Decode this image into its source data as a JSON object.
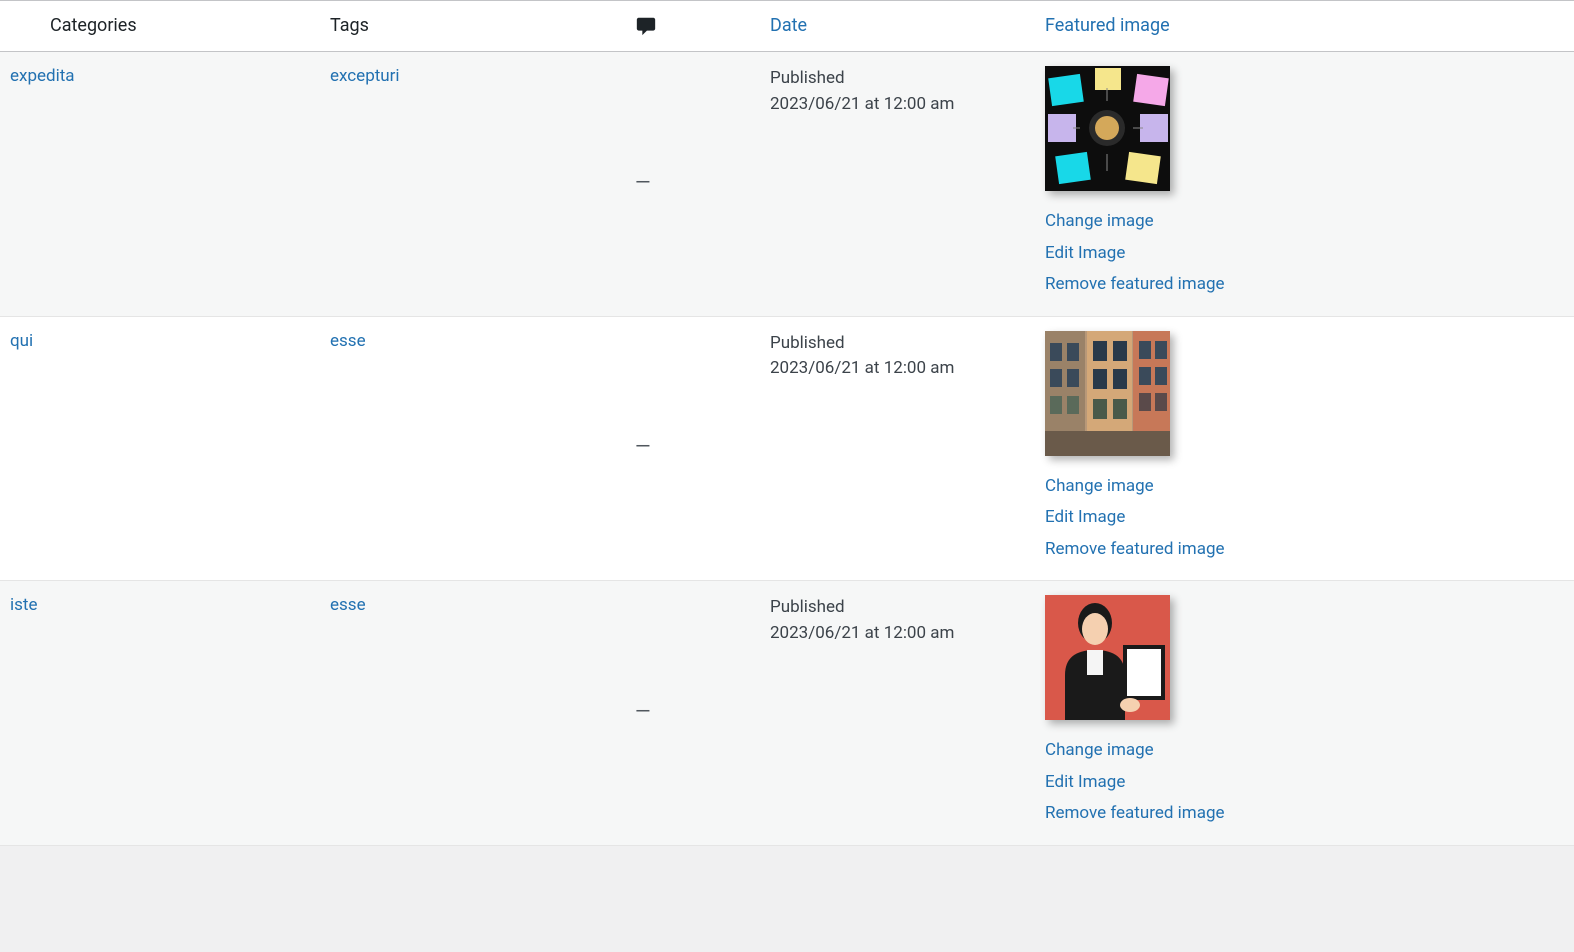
{
  "headers": {
    "categories": "Categories",
    "tags": "Tags",
    "date": "Date",
    "featured": "Featured image"
  },
  "rows": [
    {
      "category": "expedita",
      "tag": "excepturi",
      "comments": "—",
      "status": "Published",
      "date": "2023/06/21 at 12:00 am",
      "change": "Change image",
      "edit": "Edit Image",
      "remove": "Remove featured image"
    },
    {
      "category": "qui",
      "tag": "esse",
      "comments": "—",
      "status": "Published",
      "date": "2023/06/21 at 12:00 am",
      "change": "Change image",
      "edit": "Edit Image",
      "remove": "Remove featured image"
    },
    {
      "category": "iste",
      "tag": "esse",
      "comments": "—",
      "status": "Published",
      "date": "2023/06/21 at 12:00 am",
      "change": "Change image",
      "edit": "Edit Image",
      "remove": "Remove featured image"
    }
  ]
}
